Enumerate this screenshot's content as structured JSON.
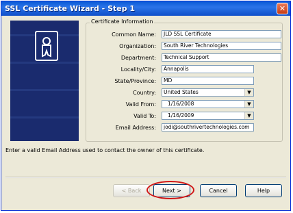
{
  "window": {
    "title": "SSL Certificate Wizard - Step 1",
    "close_glyph": "✕"
  },
  "group_label": "Certificate Information",
  "fields": [
    {
      "label": "Common Name:",
      "value": "JLD SSL Certificate"
    },
    {
      "label": "Organization:",
      "value": "South River Technologies"
    },
    {
      "label": "Department:",
      "value": "Technical Support"
    },
    {
      "label": "Locality/City:",
      "value": "Annapolis"
    },
    {
      "label": "State/Province:",
      "value": "MD"
    },
    {
      "label": "Country:",
      "value": "United States"
    },
    {
      "label": "Valid From:",
      "value": "1/16/2008"
    },
    {
      "label": "Valid To:",
      "value": "1/16/2009"
    },
    {
      "label": "Email Address:",
      "value": "jodi@southrivertechnologies.com"
    }
  ],
  "hint": "Enter a valid Email Address used to contact the owner of this certificate.",
  "buttons": {
    "back": "< Back",
    "next": "Next >",
    "cancel": "Cancel",
    "help": "Help"
  },
  "highlight_color": "#d21616"
}
